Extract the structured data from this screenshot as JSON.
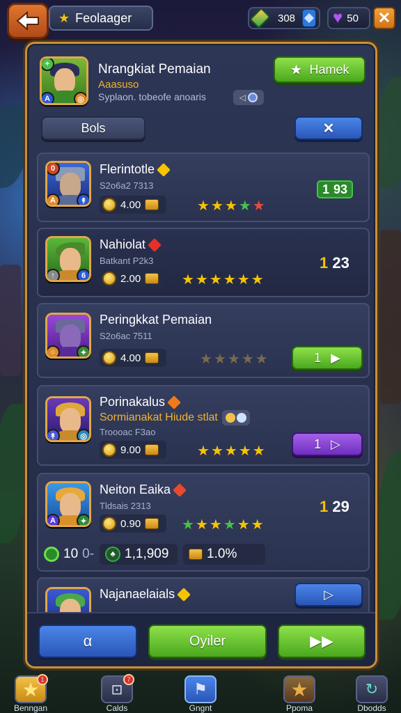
{
  "header": {
    "title": "Feolaager",
    "currency_gold": "308",
    "currency_gems": "50"
  },
  "profile": {
    "name": "Nrangkiat Pemaian",
    "subtitle": "Aaasuso",
    "description": "Syplaon. tobeofe anoaris",
    "action_label": "Hamek",
    "filter_label": "Bols",
    "close_label": "✕"
  },
  "cards": [
    {
      "name": "Flerintotle",
      "id": "S2o6a2 7313",
      "cost": "4.00",
      "stars": 5,
      "rank": "1",
      "rank_extra": "93"
    },
    {
      "name": "Nahiolat",
      "id": "Batkant P2k3",
      "cost": "2.00",
      "stars": 6,
      "rank": "1",
      "rank_extra": "23"
    },
    {
      "name": "Peringkkat Pemaian",
      "id": "S2o6ac 7511",
      "cost": "4.00",
      "stars": 5,
      "button_label": "1"
    },
    {
      "name": "Porinakalus",
      "subtitle": "Sormianakat Hiude stlat",
      "id": "Troooac F3ao",
      "cost": "9.00",
      "stars": 5,
      "button_label": "1"
    },
    {
      "name": "Neiton Eaika",
      "id": "Tldsais 2313",
      "cost": "0.90",
      "stars": 6,
      "rank": "1",
      "rank_extra": "29"
    },
    {
      "name": "Najanaelaials"
    }
  ],
  "stats": {
    "stat1": "10",
    "stat1_suffix": "0-",
    "stat2": "1,1,909",
    "stat3": "1.0%"
  },
  "bottom_buttons": {
    "left": "α",
    "center": "Oyiler",
    "right": "▶▶"
  },
  "nav": [
    {
      "label": "Benngan",
      "badge": "1"
    },
    {
      "label": "Calds",
      "badge": "7"
    },
    {
      "label": "Gngnt"
    },
    {
      "label": "Ppoma"
    },
    {
      "label": "Dbodds"
    }
  ],
  "colors": {
    "accent_gold": "#f6c400",
    "panel_border": "#c9913a",
    "green_button": "#4aa81e",
    "blue_button": "#2a56b8",
    "purple_button": "#6e2ec0"
  }
}
